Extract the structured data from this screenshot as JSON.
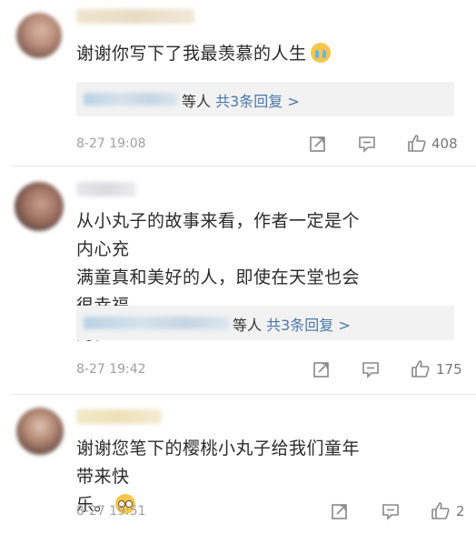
{
  "comments": [
    {
      "text": "谢谢你写下了我最羡慕的人生",
      "emoji": "crying-face-icon",
      "reply_prefix": "等人",
      "reply_count": "共3条回复 >",
      "time": "8-27 19:08",
      "likes": "408"
    },
    {
      "text_lines": [
        "从小丸子的故事来看，作者一定是个内心充",
        "满童真和美好的人，即使在天堂也会很幸福",
        "的。"
      ],
      "reply_prefix": "等人",
      "reply_count": "共3条回复 >",
      "time": "8-27 19:42",
      "likes": "175"
    },
    {
      "text_lines": [
        "谢谢您笔下的樱桃小丸子给我们童年带来快",
        "乐。"
      ],
      "emoji": "sad-face-icon",
      "time": "8-27 19:51",
      "likes": "2"
    }
  ],
  "colors": {
    "reply_link": "#4a78a8",
    "meta_text": "#a0a0a0",
    "body_text": "#2b2b2b",
    "reply_bg": "#f2f2f2"
  }
}
